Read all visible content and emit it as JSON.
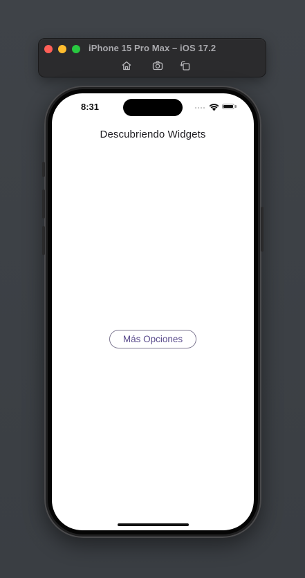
{
  "simulator": {
    "title": "iPhone 15 Pro Max – iOS 17.2",
    "toolbar_buttons": [
      {
        "icon": "home-icon"
      },
      {
        "icon": "screenshot-icon"
      },
      {
        "icon": "rotate-icon"
      }
    ]
  },
  "status_bar": {
    "time": "8:31"
  },
  "app": {
    "title": "Descubriendo Widgets",
    "button_label": "Más Opciones"
  },
  "colors": {
    "button_text": "#5a4b8c",
    "button_border": "#7c7690",
    "screen_background": "#ffffff"
  }
}
